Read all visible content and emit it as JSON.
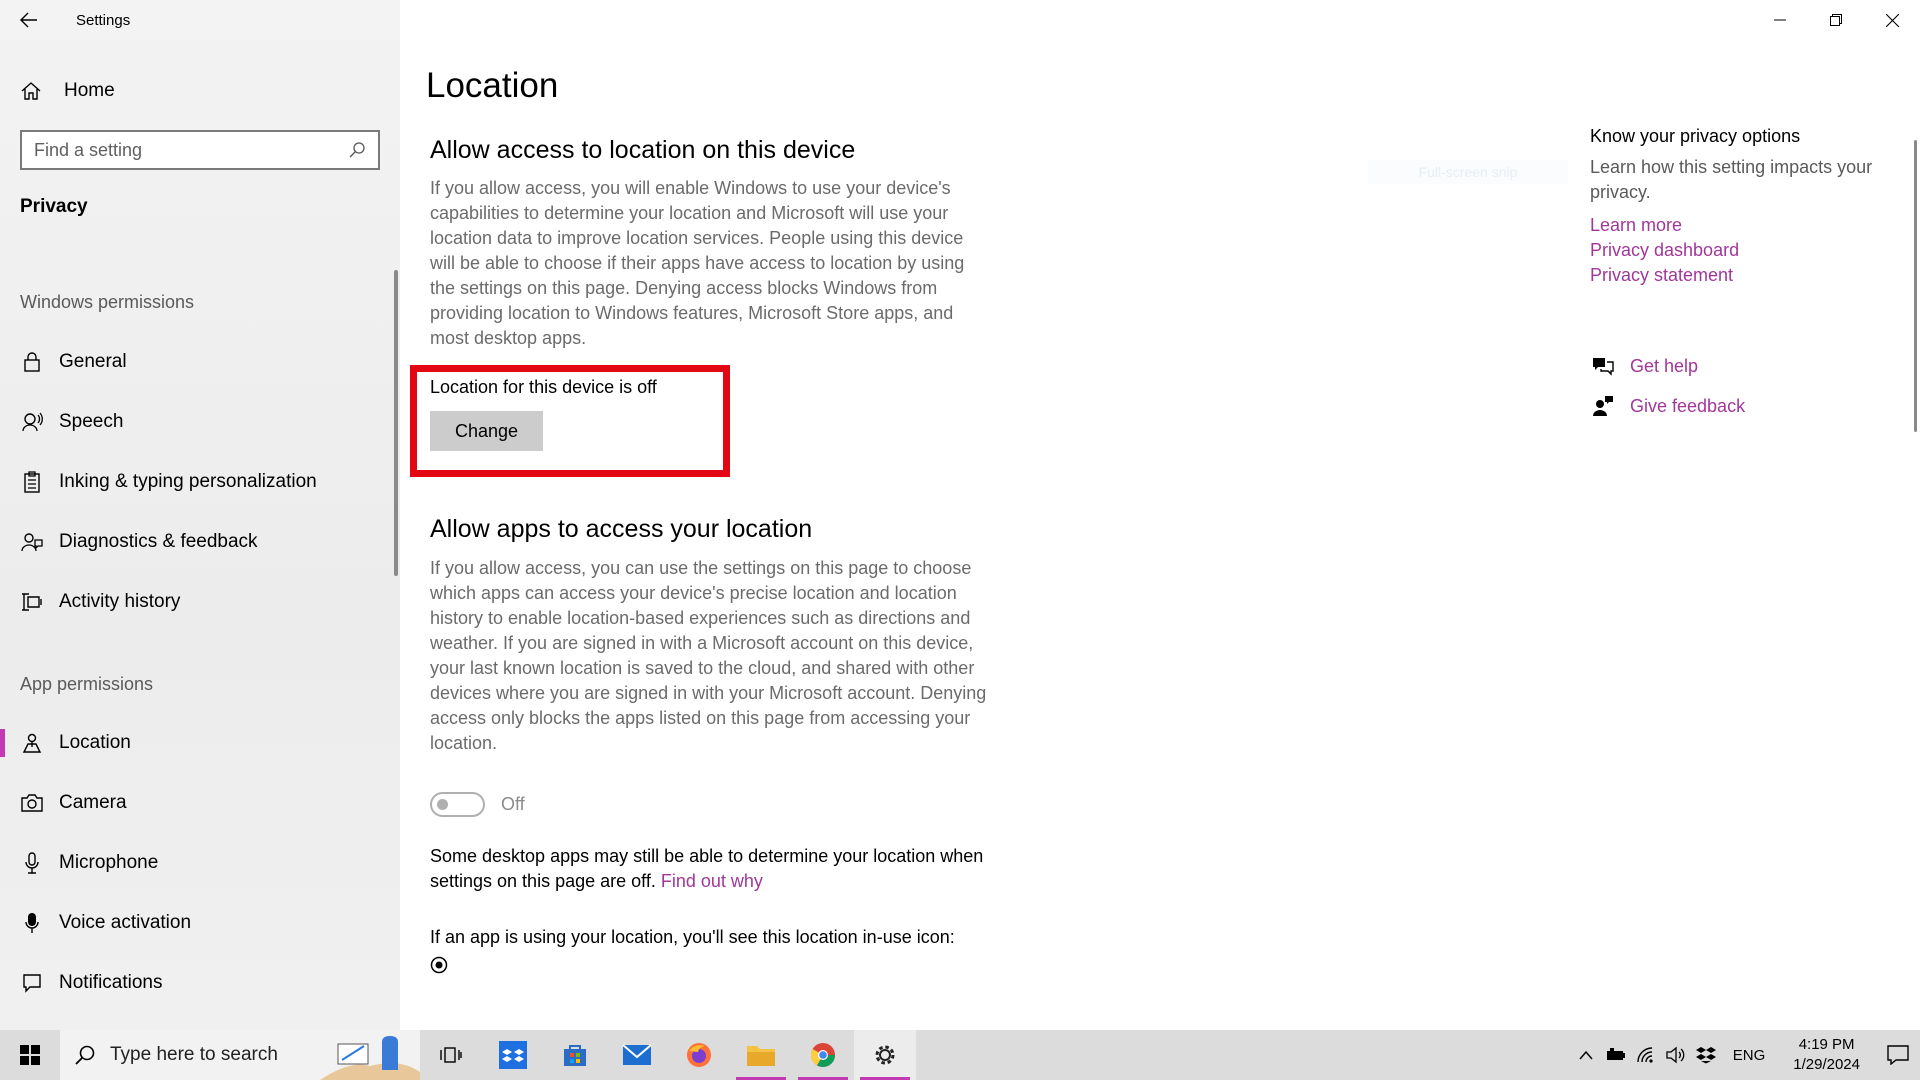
{
  "app": {
    "title": "Settings"
  },
  "sidebar": {
    "home_label": "Home",
    "search_placeholder": "Find a setting",
    "current_section": "Privacy",
    "windows_permissions_label": "Windows permissions",
    "windows_items": [
      {
        "label": "General",
        "icon": "lock-icon"
      },
      {
        "label": "Speech",
        "icon": "speech-icon"
      },
      {
        "label": "Inking & typing personalization",
        "icon": "clipboard-icon"
      },
      {
        "label": "Diagnostics & feedback",
        "icon": "diagnostics-icon"
      },
      {
        "label": "Activity history",
        "icon": "activity-history-icon"
      }
    ],
    "app_permissions_label": "App permissions",
    "app_items": [
      {
        "label": "Location",
        "icon": "location-icon",
        "active": true
      },
      {
        "label": "Camera",
        "icon": "camera-icon"
      },
      {
        "label": "Microphone",
        "icon": "microphone-icon"
      },
      {
        "label": "Voice activation",
        "icon": "voice-activation-icon"
      },
      {
        "label": "Notifications",
        "icon": "notifications-icon"
      }
    ]
  },
  "main": {
    "page_title": "Location",
    "device_section": {
      "heading": "Allow access to location on this device",
      "description": "If you allow access, you will enable Windows to use your device's capabilities to determine your location and Microsoft will use your location data to improve location services. People using this device will be able to choose if their apps have access to location by using the settings on this page. Denying access blocks Windows from providing location to Windows features, Microsoft Store apps, and most desktop apps.",
      "state_text": "Location for this device is off",
      "change_label": "Change"
    },
    "apps_section": {
      "heading": "Allow apps to access your location",
      "description": "If you allow access, you can use the settings on this page to choose which apps can access your device's precise location and location history to enable location-based experiences such as directions and weather. If you are signed in with a Microsoft account on this device, your last known location is saved to the cloud, and shared with other devices where you are signed in with your Microsoft account. Denying access only blocks the apps listed on this page from accessing your location.",
      "toggle_label": "Off",
      "toggle_on": false
    },
    "desktop_note": "Some desktop apps may still be able to determine your location when settings on this page are off.",
    "find_out_why": "Find out why",
    "inuse_note": "If an app is using your location, you'll see this location in-use icon:",
    "faded_text": "Full-screen snip"
  },
  "right_panel": {
    "title": "Know your privacy options",
    "text": "Learn how this setting impacts your privacy.",
    "links": [
      "Learn more",
      "Privacy dashboard",
      "Privacy statement"
    ],
    "get_help": "Get help",
    "give_feedback": "Give feedback"
  },
  "taskbar": {
    "search_placeholder": "Type here to search",
    "language": "ENG",
    "time": "4:19 PM",
    "date": "1/29/2024"
  },
  "colors": {
    "accent": "#c239b3",
    "link": "#a1379b",
    "highlight": "#e30613"
  }
}
